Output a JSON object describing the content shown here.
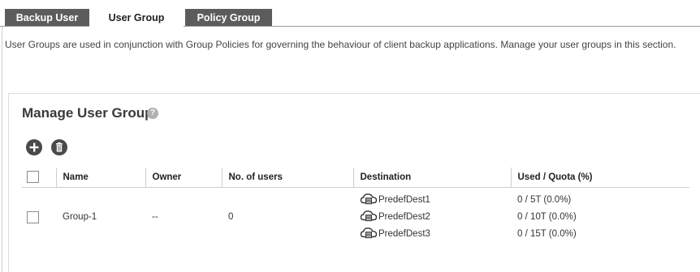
{
  "tabs": [
    {
      "label": "Backup User",
      "active": false
    },
    {
      "label": "User Group",
      "active": true
    },
    {
      "label": "Policy Group",
      "active": false
    }
  ],
  "description": "User Groups are used in conjunction with Group Policies for governing the behaviour of client backup applications. Manage your user groups in this section.",
  "panel": {
    "title": "Manage User Group",
    "help_icon": "question-circle-icon",
    "toolbar": {
      "add_icon": "plus-icon",
      "delete_icon": "trash-icon"
    }
  },
  "table": {
    "columns": [
      "Name",
      "Owner",
      "No. of users",
      "Destination",
      "Used / Quota (%)"
    ],
    "rows": [
      {
        "name": "Group-1",
        "owner": "--",
        "users": "0",
        "destinations": [
          "PredefDest1",
          "PredefDest2",
          "PredefDest3"
        ],
        "quotas": [
          "0 / 5T (0.0%)",
          "0 / 10T (0.0%)",
          "0 / 15T (0.0%)"
        ]
      }
    ],
    "destination_icon": "cloud-server-icon"
  },
  "colors": {
    "tab_inactive_bg": "#5c5c5c",
    "tab_active_bg": "#ffffff",
    "icon_dark": "#4a4a4a"
  }
}
